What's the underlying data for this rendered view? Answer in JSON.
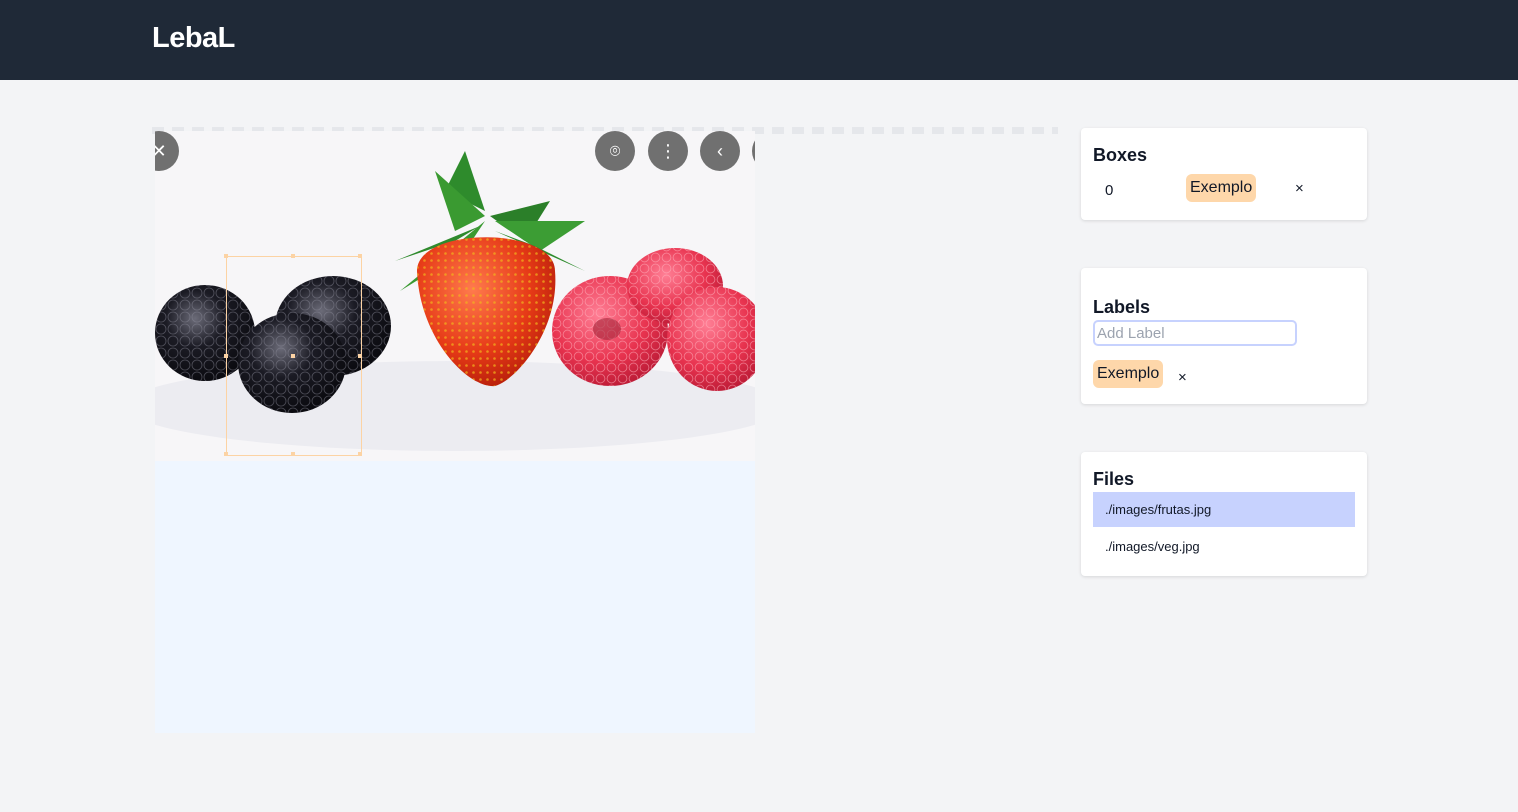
{
  "app": {
    "title": "LebaL"
  },
  "canvas": {
    "image_buttons": [
      {
        "name": "close-icon",
        "glyph": "✕"
      },
      {
        "name": "scan-icon",
        "glyph": "⌾"
      },
      {
        "name": "more-icon",
        "glyph": "⋮"
      },
      {
        "name": "chevron-left-icon",
        "glyph": "‹"
      }
    ]
  },
  "boxes": {
    "title": "Boxes",
    "items": [
      {
        "index": "0",
        "label": "Exemplo",
        "remove": "×"
      }
    ]
  },
  "labels": {
    "title": "Labels",
    "input_placeholder": "Add Label",
    "input_value": "",
    "items": [
      {
        "label": "Exemplo",
        "remove": "×"
      }
    ]
  },
  "files": {
    "title": "Files",
    "items": [
      {
        "path": "./images/frutas.jpg",
        "selected": true
      },
      {
        "path": "./images/veg.jpg",
        "selected": false
      }
    ]
  },
  "colors": {
    "topbar": "#1f2937",
    "tag": "#fed7aa",
    "selected_file": "#c7d2fe",
    "bbox": "#fcd3a4"
  }
}
